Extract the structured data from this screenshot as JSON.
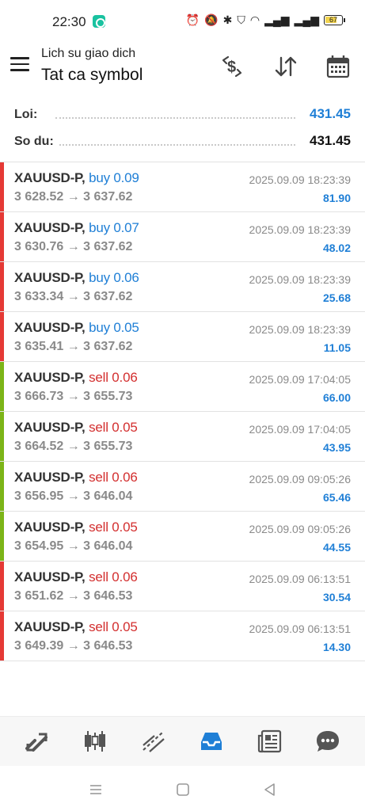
{
  "status_bar": {
    "time": "22:30",
    "battery": "67"
  },
  "header": {
    "subtitle": "Lich su giao dich",
    "title": "Tat ca symbol",
    "icons": [
      "menu-icon",
      "currency-exchange-icon",
      "sort-icon",
      "calendar-icon"
    ]
  },
  "summary": {
    "profit_label": "Loi:",
    "profit_value": "431.45",
    "balance_label": "So du:",
    "balance_value": "431.45"
  },
  "deals": [
    {
      "symbol": "XAUUSD-P,",
      "direction": "buy 0.09",
      "side": "buy",
      "prices": "3 628.52 → 3 637.62",
      "time": "2025.09.09 18:23:39",
      "profit": "81.90",
      "bar_color": "#e53935"
    },
    {
      "symbol": "XAUUSD-P,",
      "direction": "buy 0.07",
      "side": "buy",
      "prices": "3 630.76 → 3 637.62",
      "time": "2025.09.09 18:23:39",
      "profit": "48.02",
      "bar_color": "#e53935"
    },
    {
      "symbol": "XAUUSD-P,",
      "direction": "buy 0.06",
      "side": "buy",
      "prices": "3 633.34 → 3 637.62",
      "time": "2025.09.09 18:23:39",
      "profit": "25.68",
      "bar_color": "#e53935"
    },
    {
      "symbol": "XAUUSD-P,",
      "direction": "buy 0.05",
      "side": "buy",
      "prices": "3 635.41 → 3 637.62",
      "time": "2025.09.09 18:23:39",
      "profit": "11.05",
      "bar_color": "#e53935"
    },
    {
      "symbol": "XAUUSD-P,",
      "direction": "sell 0.06",
      "side": "sell",
      "prices": "3 666.73 → 3 655.73",
      "time": "2025.09.09 17:04:05",
      "profit": "66.00",
      "bar_color": "#7cb518"
    },
    {
      "symbol": "XAUUSD-P,",
      "direction": "sell 0.05",
      "side": "sell",
      "prices": "3 664.52 → 3 655.73",
      "time": "2025.09.09 17:04:05",
      "profit": "43.95",
      "bar_color": "#7cb518"
    },
    {
      "symbol": "XAUUSD-P,",
      "direction": "sell 0.06",
      "side": "sell",
      "prices": "3 656.95 → 3 646.04",
      "time": "2025.09.09 09:05:26",
      "profit": "65.46",
      "bar_color": "#7cb518"
    },
    {
      "symbol": "XAUUSD-P,",
      "direction": "sell 0.05",
      "side": "sell",
      "prices": "3 654.95 → 3 646.04",
      "time": "2025.09.09 09:05:26",
      "profit": "44.55",
      "bar_color": "#7cb518"
    },
    {
      "symbol": "XAUUSD-P,",
      "direction": "sell 0.06",
      "side": "sell",
      "prices": "3 651.62 → 3 646.53",
      "time": "2025.09.09 06:13:51",
      "profit": "30.54",
      "bar_color": "#e53935"
    },
    {
      "symbol": "XAUUSD-P,",
      "direction": "sell 0.05",
      "side": "sell",
      "prices": "3 649.39 → 3 646.53",
      "time": "2025.09.09 06:13:51",
      "profit": "14.30",
      "bar_color": "#e53935"
    }
  ],
  "bottom_nav": {
    "items": [
      "quotes-icon",
      "chart-icon",
      "trade-icon",
      "history-icon",
      "news-icon",
      "chat-icon"
    ],
    "active": "history-icon",
    "active_color": "#1f7fd6",
    "icon_color": "#555555"
  },
  "system_nav": [
    "recent-apps-icon",
    "home-icon",
    "back-icon"
  ]
}
